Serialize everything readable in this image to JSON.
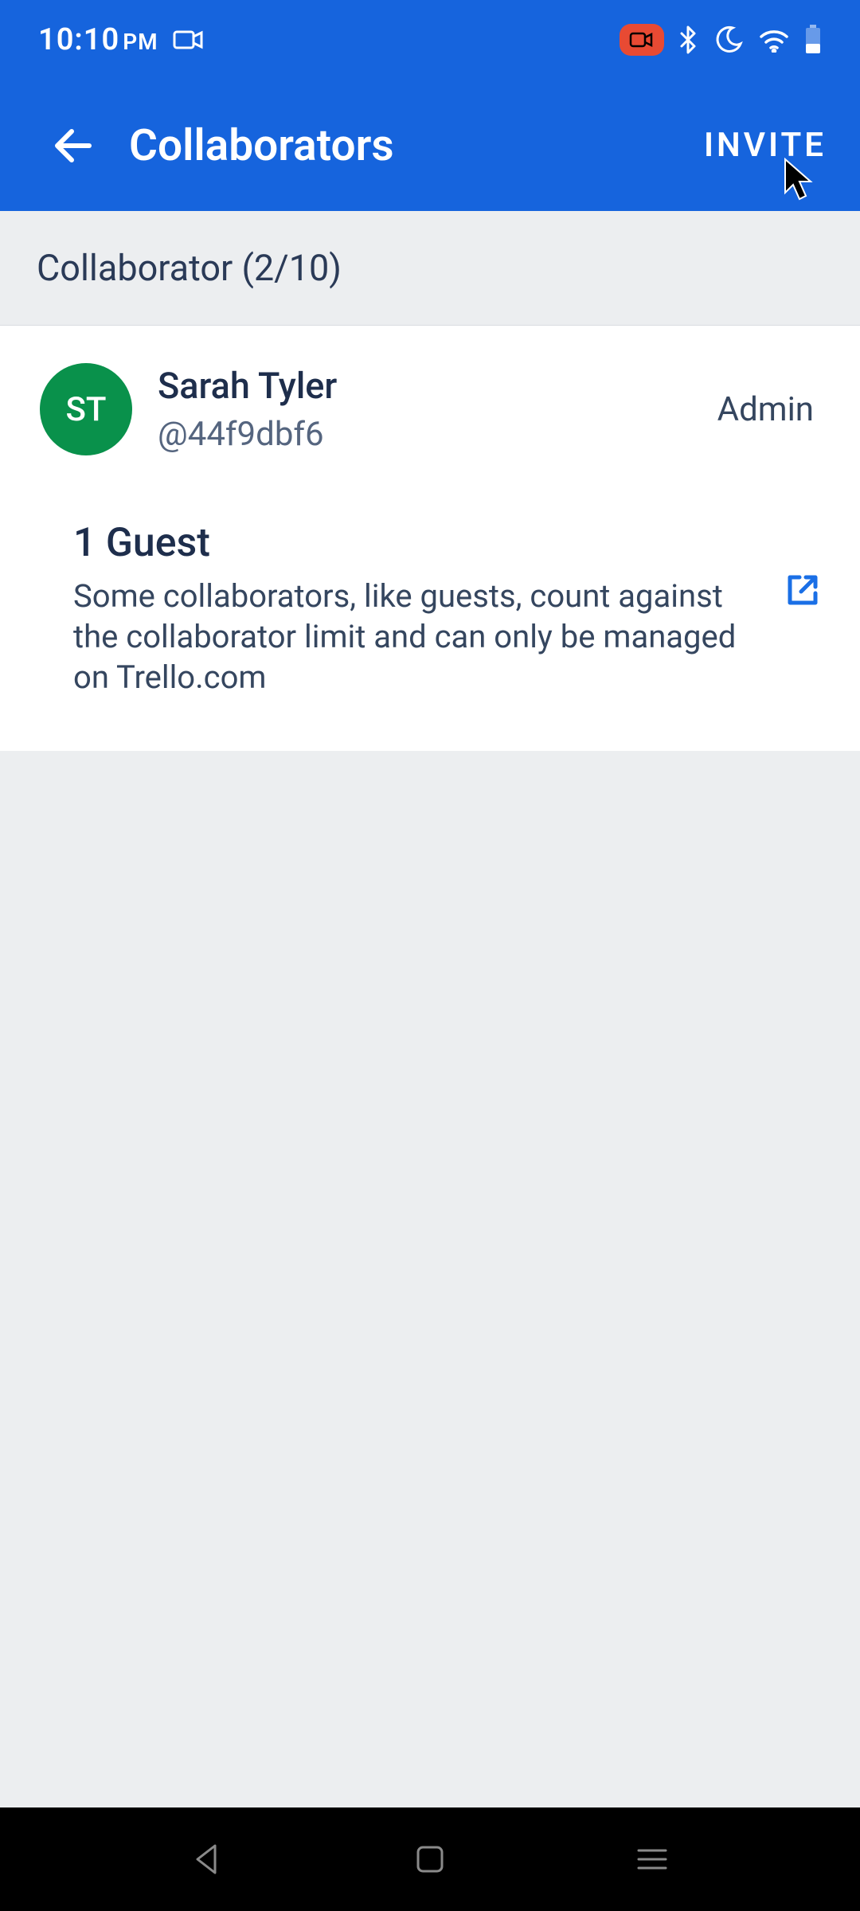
{
  "statusbar": {
    "time": "10:10",
    "ampm": "PM"
  },
  "appbar": {
    "title": "Collaborators",
    "invite_label": "INVITE"
  },
  "section": {
    "heading": "Collaborator (2/10)"
  },
  "collaborator": {
    "initials": "ST",
    "name": "Sarah Tyler",
    "handle": "@44f9dbf6",
    "role": "Admin"
  },
  "guest": {
    "title": "1 Guest",
    "description": "Some collaborators, like guests, count against the collaborator limit and can only be managed on Trello.com"
  },
  "colors": {
    "accent": "#1664dd",
    "avatar": "#09914b",
    "recording": "#e84a33"
  }
}
